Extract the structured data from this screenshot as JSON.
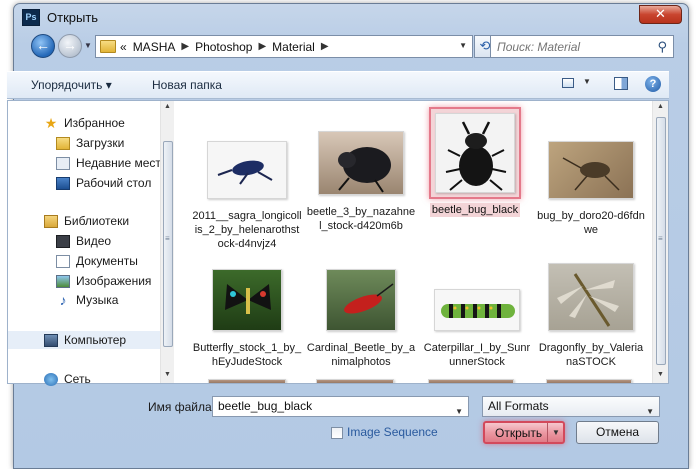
{
  "window": {
    "app_badge": "Ps",
    "title": "Открыть",
    "close_glyph": "✕"
  },
  "nav": {
    "back_glyph": "←",
    "forward_glyph": "→",
    "breadcrumb_lead": "«",
    "breadcrumbs": [
      "MASHA",
      "Photoshop",
      "Material"
    ],
    "search_placeholder": "Поиск: Material",
    "refresh_glyph": "⟲"
  },
  "toolbar": {
    "organize_label": "Упорядочить ▾",
    "new_folder_label": "Новая папка",
    "help_glyph": "?"
  },
  "sidebar": {
    "favorites_label": "Избранное",
    "favorites": [
      "Загрузки",
      "Недавние места",
      "Рабочий стол"
    ],
    "libraries_label": "Библиотеки",
    "libraries": [
      "Видео",
      "Документы",
      "Изображения",
      "Музыка"
    ],
    "computer_label": "Компьютер",
    "network_label": "Сеть"
  },
  "files": [
    {
      "label": "2011__sagra_longicollis_2_by_helenarothstock-d4nvjz4",
      "icon": "blue-beetle-thumbnail",
      "selected": false
    },
    {
      "label": "beetle_3_by_nazahnel_stock-d420m6b",
      "icon": "dark-beetle-thumbnail",
      "selected": false
    },
    {
      "label": "beetle_bug_black",
      "icon": "black-beetle-thumbnail",
      "selected": true
    },
    {
      "label": "bug_by_doro20-d6fdnwe",
      "icon": "ground-bug-thumbnail",
      "selected": false
    },
    {
      "label": "Butterfly_stock_1_by_hEyJudeStock",
      "icon": "butterfly-thumbnail",
      "selected": false
    },
    {
      "label": "Cardinal_Beetle_by_animalphotos",
      "icon": "red-beetle-thumbnail",
      "selected": false
    },
    {
      "label": "Caterpillar_I_by_SunrunnerStock",
      "icon": "caterpillar-thumbnail",
      "selected": false
    },
    {
      "label": "Dragonfly_by_ValerianaSTOCK",
      "icon": "dragonfly-thumbnail",
      "selected": false
    }
  ],
  "footer": {
    "filename_label": "Имя файла:",
    "filename_value": "beetle_bug_black",
    "format_value": "All Formats",
    "sequence_label": "Image Sequence",
    "open_label": "Открыть",
    "cancel_label": "Отмена"
  },
  "colors": {
    "window_frame": "#b9cde6",
    "selection_highlight": "#f3d4d7",
    "selection_border": "#e4798a",
    "open_button": "#ec99a3"
  }
}
